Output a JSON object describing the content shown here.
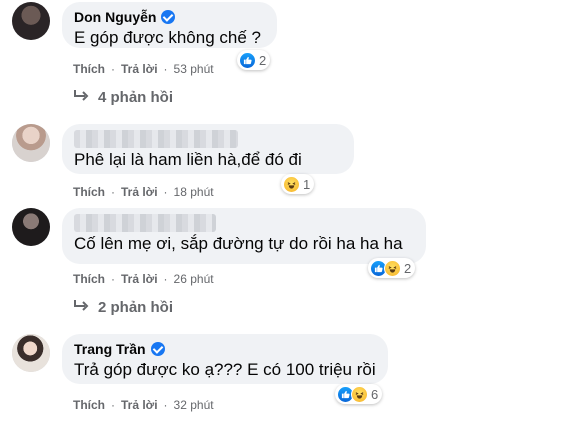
{
  "actions": {
    "like": "Thích",
    "reply": "Trả lời",
    "dot": "·"
  },
  "comments": [
    {
      "author": "Don Nguyễn",
      "verified": true,
      "text": "E góp được không chế ?",
      "time": "53 phút",
      "reaction_icons": [
        "like-icon"
      ],
      "reaction_count": "2",
      "replies_label": "4 phản hồi"
    },
    {
      "author": "",
      "verified": false,
      "text": "Phê lại là ham liền hà,để đó đi",
      "time": "18 phút",
      "reaction_icons": [
        "haha-icon"
      ],
      "reaction_count": "1"
    },
    {
      "author": "",
      "verified": false,
      "text": "Cố lên mẹ ơi, sắp đường tự do rồi ha ha ha",
      "time": "26 phút",
      "reaction_icons": [
        "like-icon",
        "haha-icon"
      ],
      "reaction_count": "2",
      "replies_label": "2 phản hồi"
    },
    {
      "author": "Trang Trần",
      "verified": true,
      "text": "Trả góp được ko ạ??? E có 100 triệu rồi",
      "time": "32 phút",
      "reaction_icons": [
        "like-icon",
        "haha-icon"
      ],
      "reaction_count": "6"
    }
  ],
  "colors": {
    "like_blue": "#1877f2",
    "meta_gray": "#65676b",
    "bubble_bg": "#f0f2f5"
  }
}
